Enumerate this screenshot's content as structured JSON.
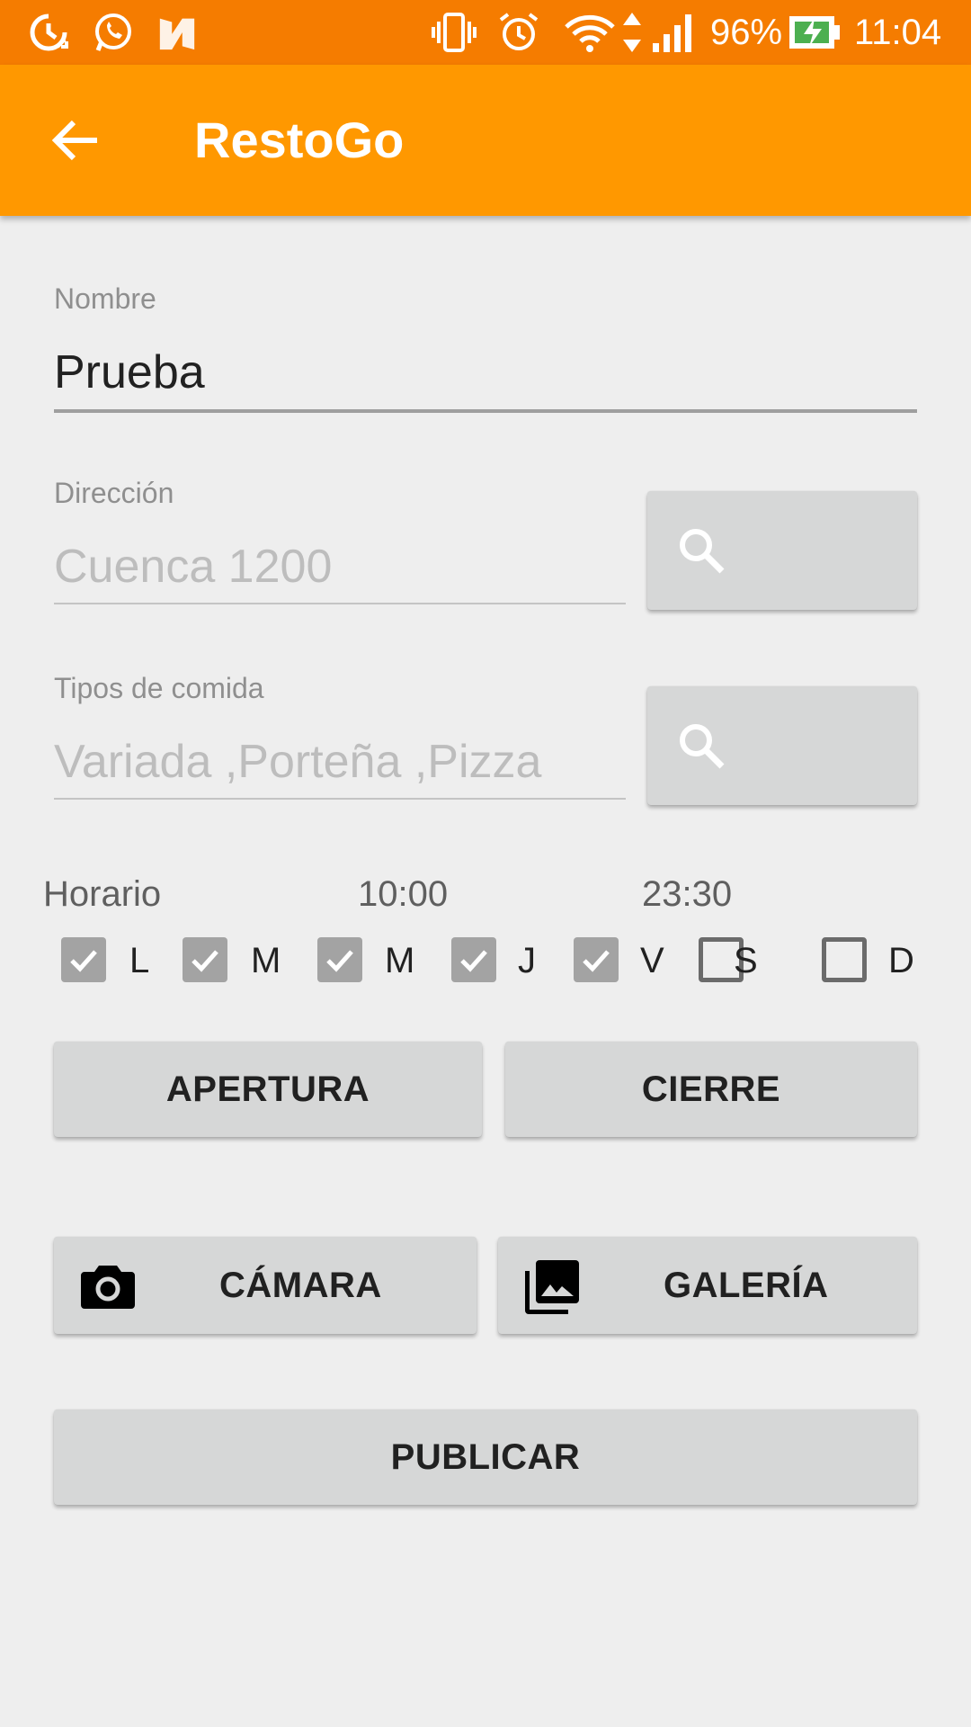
{
  "status_bar": {
    "battery_percent": "96%",
    "time": "11:04",
    "icons": [
      "data-saver-icon",
      "whatsapp-icon",
      "n-notification-icon",
      "vibrate-icon",
      "alarm-icon",
      "wifi-icon",
      "data-arrows-icon",
      "signal-icon",
      "battery-charging-icon"
    ]
  },
  "app_bar": {
    "title": "RestoGo",
    "back_icon": "arrow-back-icon"
  },
  "form": {
    "nombre": {
      "label": "Nombre",
      "value": "Prueba"
    },
    "direccion": {
      "label": "Dirección",
      "placeholder": "Cuenca 1200"
    },
    "tipos": {
      "label": "Tipos de comida",
      "placeholder": "Variada ,Porteña ,Pizza"
    },
    "search_icon": "search-icon"
  },
  "horario": {
    "label": "Horario",
    "open_time": "10:00",
    "close_time": "23:30",
    "days": [
      {
        "label": "L",
        "checked": true
      },
      {
        "label": "M",
        "checked": true
      },
      {
        "label": "M",
        "checked": true
      },
      {
        "label": "J",
        "checked": true
      },
      {
        "label": "V",
        "checked": true
      },
      {
        "label": "S",
        "checked": false
      },
      {
        "label": "D",
        "checked": false
      }
    ]
  },
  "buttons": {
    "apertura": "APERTURA",
    "cierre": "CIERRE",
    "camara": "CÁMARA",
    "galeria": "GALERÍA",
    "publicar": "PUBLICAR"
  },
  "colors": {
    "status_bar": "#f57c00",
    "app_bar": "#ff9800",
    "background": "#eeeeee",
    "button": "#d6d7d7",
    "checkbox_checked": "#a3a3a3"
  }
}
